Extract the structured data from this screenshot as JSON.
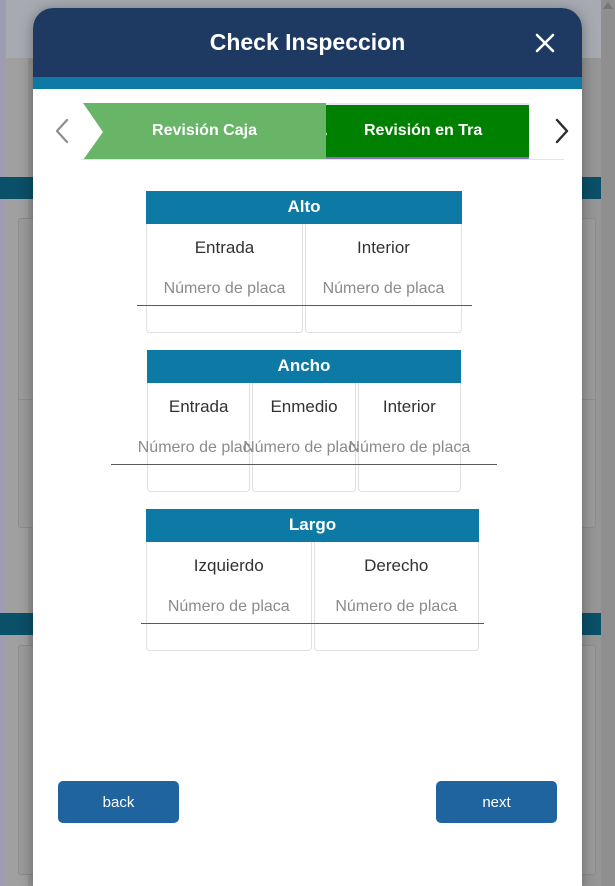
{
  "modal": {
    "title": "Check Inspeccion",
    "close_icon": "close-icon"
  },
  "stepper": {
    "prev_icon": "chevron-left-icon",
    "next_icon": "chevron-right-icon",
    "steps": [
      {
        "label": "Revisión Caja",
        "state": "done",
        "color": "#68b568"
      },
      {
        "label": "Revisión en Tra",
        "state": "active",
        "color": "#008000"
      }
    ]
  },
  "sections": [
    {
      "title": "Alto",
      "columns": [
        {
          "label": "Entrada",
          "value": "",
          "placeholder": "Número de placa"
        },
        {
          "label": "Interior",
          "value": "",
          "placeholder": "Número de placa"
        }
      ]
    },
    {
      "title": "Ancho",
      "columns": [
        {
          "label": "Entrada",
          "value": "",
          "placeholder": "Número de placa"
        },
        {
          "label": "Enmedio",
          "value": "",
          "placeholder": "Número de placa"
        },
        {
          "label": "Interior",
          "value": "",
          "placeholder": "Número de placa"
        }
      ]
    },
    {
      "title": "Largo",
      "columns": [
        {
          "label": "Izquierdo",
          "value": "",
          "placeholder": "Número de placa"
        },
        {
          "label": "Derecho",
          "value": "",
          "placeholder": "Número de placa"
        }
      ]
    }
  ],
  "footer": {
    "back_label": "back",
    "next_label": "next"
  },
  "theme": {
    "header_navy": "#1e3a63",
    "accent_teal": "#0c7aa5",
    "button_blue": "#1f639f",
    "step_done_green": "#68b568",
    "step_active_green": "#008000",
    "step_active_underline": "#8a6fc0"
  }
}
